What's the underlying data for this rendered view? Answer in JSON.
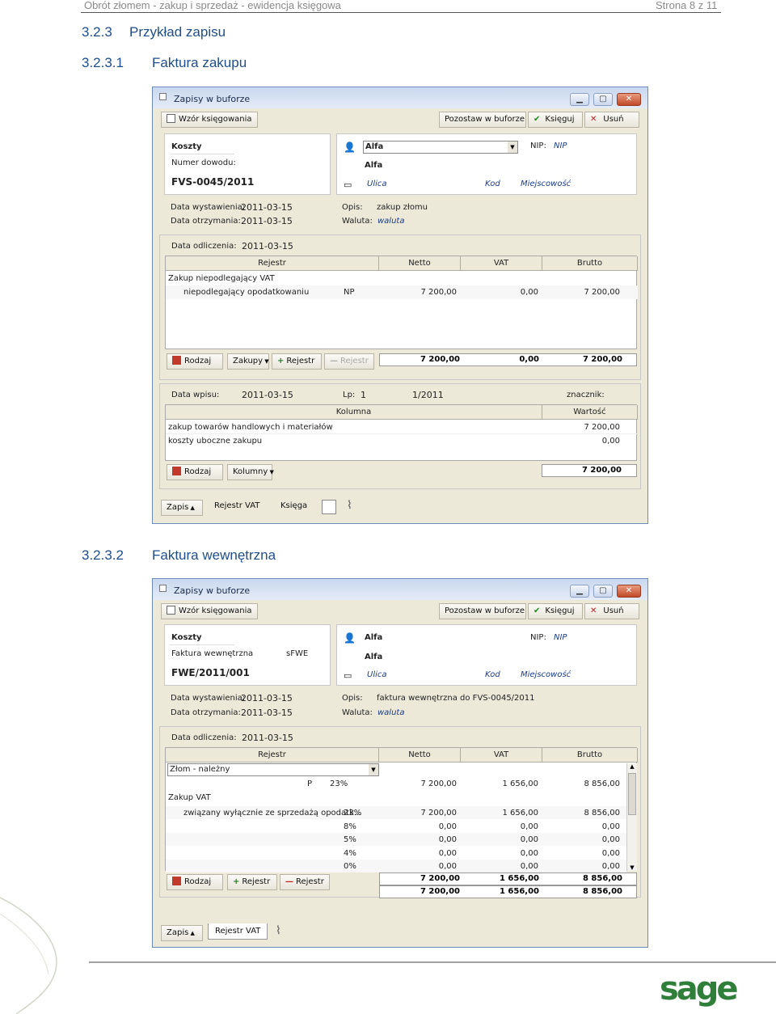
{
  "page_header": {
    "left": "Obrót złomem - zakup i sprzedaż - ewidencja księgowa",
    "right": "Strona 8 z 11"
  },
  "headings": [
    {
      "num": "3.2.3",
      "text": "Przykład zapisu"
    },
    {
      "num": "3.2.3.1",
      "text": "Faktura zakupu"
    },
    {
      "num": "3.2.3.2",
      "text": "Faktura wewnętrzna"
    }
  ],
  "window_controls": {
    "minimize": "▁",
    "maximize": "▢",
    "close": "✕"
  },
  "win1": {
    "title": "Zapisy w buforze",
    "toolbar": {
      "wzor": "Wzór księgowania",
      "pozostaw": "Pozostaw w buforze",
      "ksieguj": "Księguj",
      "usun": "Usuń"
    },
    "doc": {
      "type": "Koszty",
      "num_label": "Numer dowodu:",
      "number": "FVS-0045/2011"
    },
    "kontrahent": {
      "code": "Alfa",
      "name": "Alfa",
      "nip_label": "NIP:",
      "nip": "NIP",
      "ulica": "Ulica",
      "kod": "Kod",
      "miejscowosc": "Miejscowość"
    },
    "dates": {
      "wyst_label": "Data wystawienia:",
      "wyst": "2011-03-15",
      "otrz_label": "Data otrzymania:",
      "otrz": "2011-03-15",
      "opis_label": "Opis:",
      "opis": "zakup złomu",
      "waluta_label": "Waluta:",
      "waluta": "waluta"
    },
    "vat": {
      "odl_label": "Data odliczenia:",
      "odl": "2011-03-15",
      "cols": [
        "Rejestr",
        "Netto",
        "VAT",
        "Brutto"
      ],
      "group": "Zakup niepodlegający VAT",
      "row": {
        "name": "niepodlegający opodatkowaniu",
        "stawka": "NP",
        "netto": "7 200,00",
        "vat": "0,00",
        "brutto": "7 200,00"
      },
      "buttons": {
        "rodzaj": "Rodzaj",
        "zakupy": "Zakupy",
        "rejestr_add": "Rejestr",
        "rejestr_del": "Rejestr"
      },
      "totals": {
        "netto": "7 200,00",
        "vat": "0,00",
        "brutto": "7 200,00"
      }
    },
    "kpir": {
      "wpis_label": "Data wpisu:",
      "wpis": "2011-03-15",
      "lp_label": "Lp:",
      "lp": "1",
      "lp_num": "1/2011",
      "znacznik_label": "znacznik:",
      "cols": [
        "Kolumna",
        "Wartość"
      ],
      "rows": [
        {
          "k": "zakup towarów handlowych i materiałów",
          "v": "7 200,00"
        },
        {
          "k": "koszty uboczne zakupu",
          "v": "0,00"
        }
      ],
      "buttons": {
        "rodzaj": "Rodzaj",
        "kolumny": "Kolumny"
      },
      "total": "7 200,00"
    },
    "tabs": {
      "zapis": "Zapis",
      "rejestr": "Rejestr VAT",
      "ksiega": "Księga"
    }
  },
  "win2": {
    "title": "Zapisy w buforze",
    "toolbar": {
      "wzor": "Wzór księgowania",
      "pozostaw": "Pozostaw w buforze",
      "ksieguj": "Księguj",
      "usun": "Usuń"
    },
    "doc": {
      "type": "Koszty",
      "kind": "Faktura wewnętrzna",
      "kind_code": "sFWE",
      "number": "FWE/2011/001"
    },
    "kontrahent": {
      "code": "Alfa",
      "name": "Alfa",
      "nip_label": "NIP:",
      "nip": "NIP",
      "ulica": "Ulica",
      "kod": "Kod",
      "miejscowosc": "Miejscowość"
    },
    "dates": {
      "wyst_label": "Data wystawienia:",
      "wyst": "2011-03-15",
      "otrz_label": "Data otrzymania:",
      "otrz": "2011-03-15",
      "opis_label": "Opis:",
      "opis": "faktura wewnętrzna do FVS-0045/2011",
      "waluta_label": "Waluta:",
      "waluta": "waluta"
    },
    "vat": {
      "odl_label": "Data odliczenia:",
      "odl": "2011-03-15",
      "cols": [
        "Rejestr",
        "Netto",
        "VAT",
        "Brutto"
      ],
      "combo": "Złom - należny",
      "p_row": {
        "p": "P",
        "stawka": "23%",
        "netto": "7 200,00",
        "vat": "1 656,00",
        "brutto": "8 856,00"
      },
      "group": "Zakup VAT",
      "rows": [
        {
          "name": "związany wyłącznie ze sprzedażą opodatk...",
          "stawka": "23%",
          "netto": "7 200,00",
          "vat": "1 656,00",
          "brutto": "8 856,00"
        },
        {
          "name": "",
          "stawka": "8%",
          "netto": "0,00",
          "vat": "0,00",
          "brutto": "0,00"
        },
        {
          "name": "",
          "stawka": "5%",
          "netto": "0,00",
          "vat": "0,00",
          "brutto": "0,00"
        },
        {
          "name": "",
          "stawka": "4%",
          "netto": "0,00",
          "vat": "0,00",
          "brutto": "0,00"
        },
        {
          "name": "",
          "stawka": "0%",
          "netto": "0,00",
          "vat": "0,00",
          "brutto": "0,00"
        }
      ],
      "buttons": {
        "rodzaj": "Rodzaj",
        "rejestr_add": "Rejestr",
        "rejestr_del": "Rejestr"
      },
      "totals": [
        {
          "netto": "7 200,00",
          "vat": "1 656,00",
          "brutto": "8 856,00"
        },
        {
          "netto": "7 200,00",
          "vat": "1 656,00",
          "brutto": "8 856,00"
        }
      ]
    },
    "tabs": {
      "zapis": "Zapis",
      "rejestr": "Rejestr VAT"
    }
  },
  "logo": "sage",
  "colors": {
    "heading": "#1f4e8c",
    "logo": "#2f7f3b",
    "total_link": "#1a3c8c"
  }
}
